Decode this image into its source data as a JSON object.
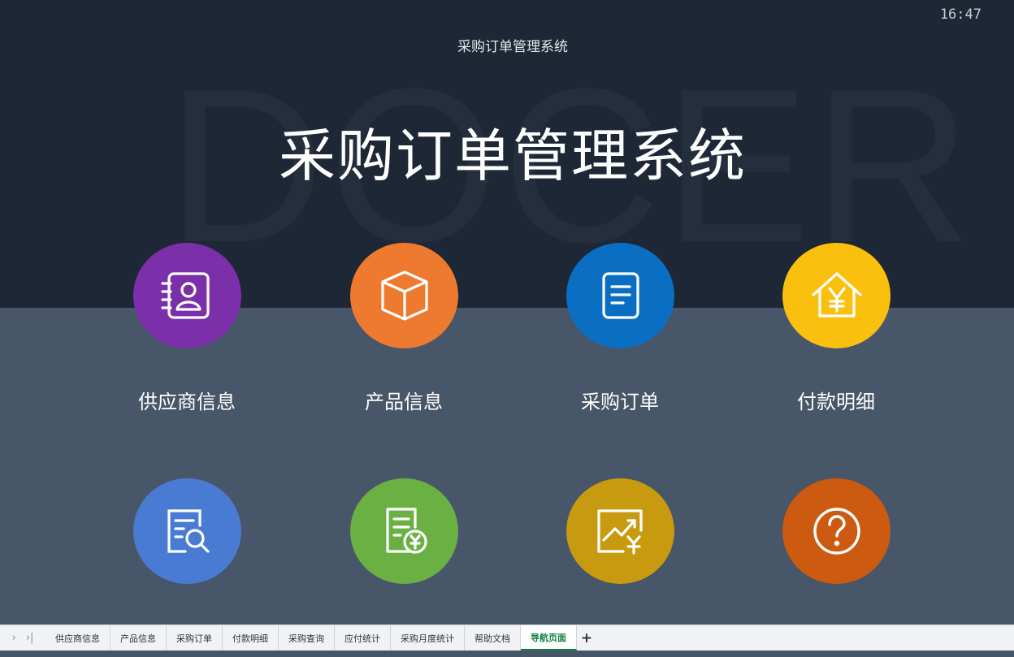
{
  "header": {
    "clock": "16:47",
    "small_title": "采购订单管理系统",
    "big_title": "采购订单管理系统",
    "watermark": "DOCER"
  },
  "nav_items": [
    {
      "label": "供应商信息",
      "icon": "supplier-card-icon",
      "color": "#7b2fa8"
    },
    {
      "label": "产品信息",
      "icon": "product-box-icon",
      "color": "#ee7a2f"
    },
    {
      "label": "采购订单",
      "icon": "order-document-icon",
      "color": "#0a6fc3"
    },
    {
      "label": "付款明细",
      "icon": "payment-house-icon",
      "color": "#fbbf0e"
    },
    {
      "label": "",
      "icon": "document-search-icon",
      "color": "#4a7bd3"
    },
    {
      "label": "",
      "icon": "document-money-icon",
      "color": "#6bb043"
    },
    {
      "label": "",
      "icon": "trend-chart-icon",
      "color": "#c89a0f"
    },
    {
      "label": "",
      "icon": "question-icon",
      "color": "#cc5a10"
    }
  ],
  "sheet_bar": {
    "tabs": [
      "供应商信息",
      "产品信息",
      "采购订单",
      "付款明细",
      "采购查询",
      "应付统计",
      "采购月度统计",
      "帮助文档",
      "导航页面"
    ],
    "active_tab": "导航页面",
    "add_label": "+"
  }
}
